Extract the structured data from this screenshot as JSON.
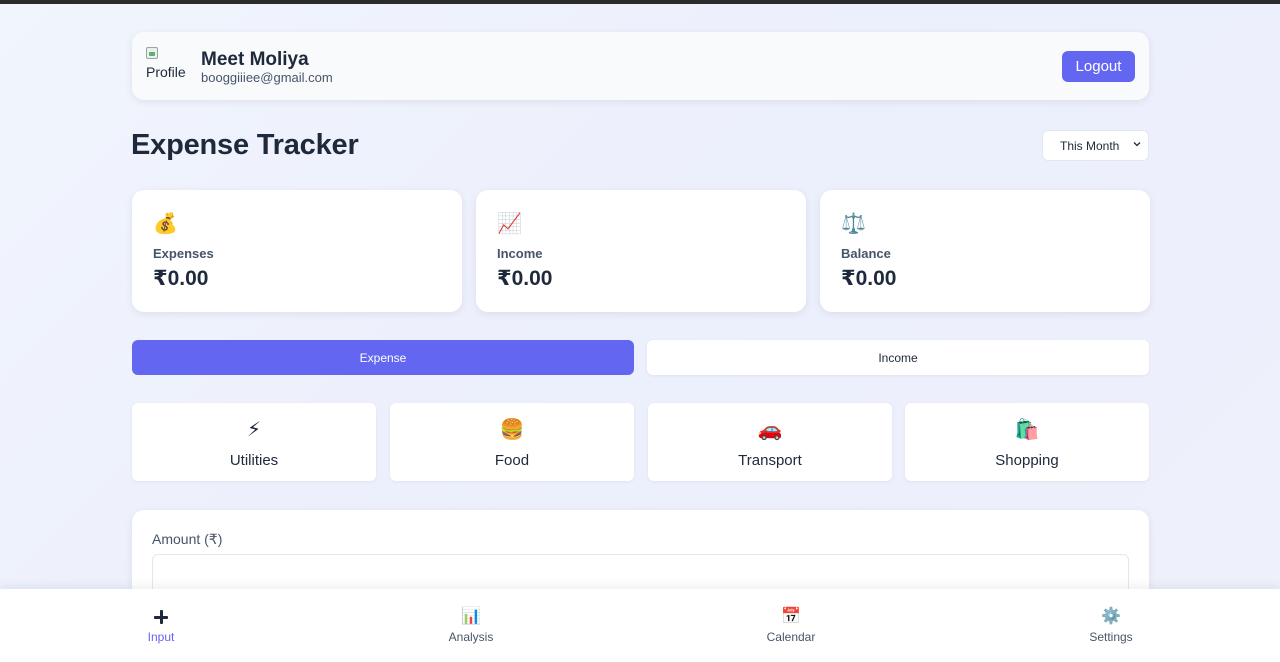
{
  "profile": {
    "image_alt": "Profile",
    "name": "Meet Moliya",
    "email": "booggiiiee@gmail.com",
    "logout_label": "Logout"
  },
  "header": {
    "title": "Expense Tracker",
    "period_selected": "This Month"
  },
  "stats": [
    {
      "icon": "money-bag-icon",
      "emoji": "💰",
      "label": "Expenses",
      "value": "₹0.00"
    },
    {
      "icon": "chart-up-icon",
      "emoji": "📈",
      "label": "Income",
      "value": "₹0.00"
    },
    {
      "icon": "scales-icon",
      "emoji": "⚖️",
      "label": "Balance",
      "value": "₹0.00"
    }
  ],
  "tabs": {
    "expense_label": "Expense",
    "income_label": "Income",
    "active": "Expense"
  },
  "categories": [
    {
      "icon": "lightning-icon",
      "emoji": "⚡",
      "name": "Utilities"
    },
    {
      "icon": "burger-icon",
      "emoji": "🍔",
      "name": "Food"
    },
    {
      "icon": "car-icon",
      "emoji": "🚗",
      "name": "Transport"
    },
    {
      "icon": "shopping-bags-icon",
      "emoji": "🛍️",
      "name": "Shopping"
    }
  ],
  "form": {
    "amount_label": "Amount (₹)",
    "amount_value": ""
  },
  "nav": {
    "items": [
      {
        "icon": "plus-icon",
        "emoji": "",
        "label": "Input"
      },
      {
        "icon": "bar-chart-icon",
        "emoji": "📊",
        "label": "Analysis"
      },
      {
        "icon": "calendar-icon",
        "emoji": "📅",
        "label": "Calendar"
      },
      {
        "icon": "gear-icon",
        "emoji": "⚙️",
        "label": "Settings"
      }
    ],
    "active": "Input"
  },
  "colors": {
    "accent": "#6366f1",
    "text_primary": "#1e293b",
    "text_secondary": "#475569",
    "card_bg": "#ffffff"
  }
}
